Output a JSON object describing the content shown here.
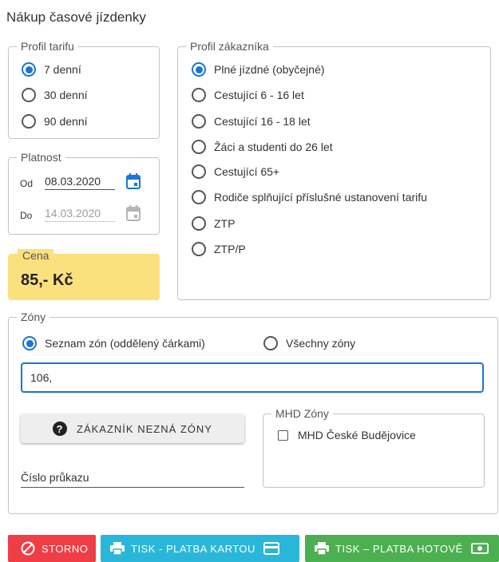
{
  "page": {
    "title": "Nákup časové jízdenky"
  },
  "tariff_profile": {
    "legend": "Profil tarifu",
    "options": [
      "7 denní",
      "30 denní",
      "90 denní"
    ],
    "selected_index": 0
  },
  "validity": {
    "legend": "Platnost",
    "from_label": "Od",
    "from_value": "08.03.2020",
    "to_label": "Do",
    "to_value": "14.03.2020"
  },
  "price": {
    "label": "Cena",
    "value": "85,- Kč"
  },
  "customer_profile": {
    "legend": "Profil zákazníka",
    "options": [
      "Plné jízdné (obyčejné)",
      "Cestující 6 - 16 let",
      "Cestující 16 - 18 let",
      "Žáci a studenti do 26 let",
      "Cestující 65+",
      "Rodiče splňující příslušné ustanovení tarifu",
      "ZTP",
      "ZTP/P"
    ],
    "selected_index": 0
  },
  "zones": {
    "legend": "Zóny",
    "option_list": "Seznam zón (oddělený čárkami)",
    "option_all": "Všechny zóny",
    "selected": "list",
    "input_value": "106,",
    "unknown_zones_button": "ZÁKAZNÍK NEZNÁ ZÓNY",
    "card_number_label": "Číslo průkazu",
    "mhd": {
      "legend": "MHD Zóny",
      "checkbox_label": "MHD České Budějovice",
      "checked": false
    }
  },
  "actions": {
    "cancel": "STORNO",
    "print_card": "TISK - PLATBA KARTOU",
    "print_cash": "TISK – PLATBA HOTOVĚ"
  },
  "colors": {
    "primary": "#1976d2",
    "price_bg": "#fbe07e",
    "cancel_bg": "#ef3e46",
    "card_bg": "#29b6d9",
    "cash_bg": "#4caf50"
  },
  "icons": {
    "help": "question-circle-icon",
    "calendar": "calendar-icon",
    "cancel": "block-icon",
    "print": "printer-icon",
    "card": "credit-card-icon",
    "cash": "cash-icon"
  }
}
